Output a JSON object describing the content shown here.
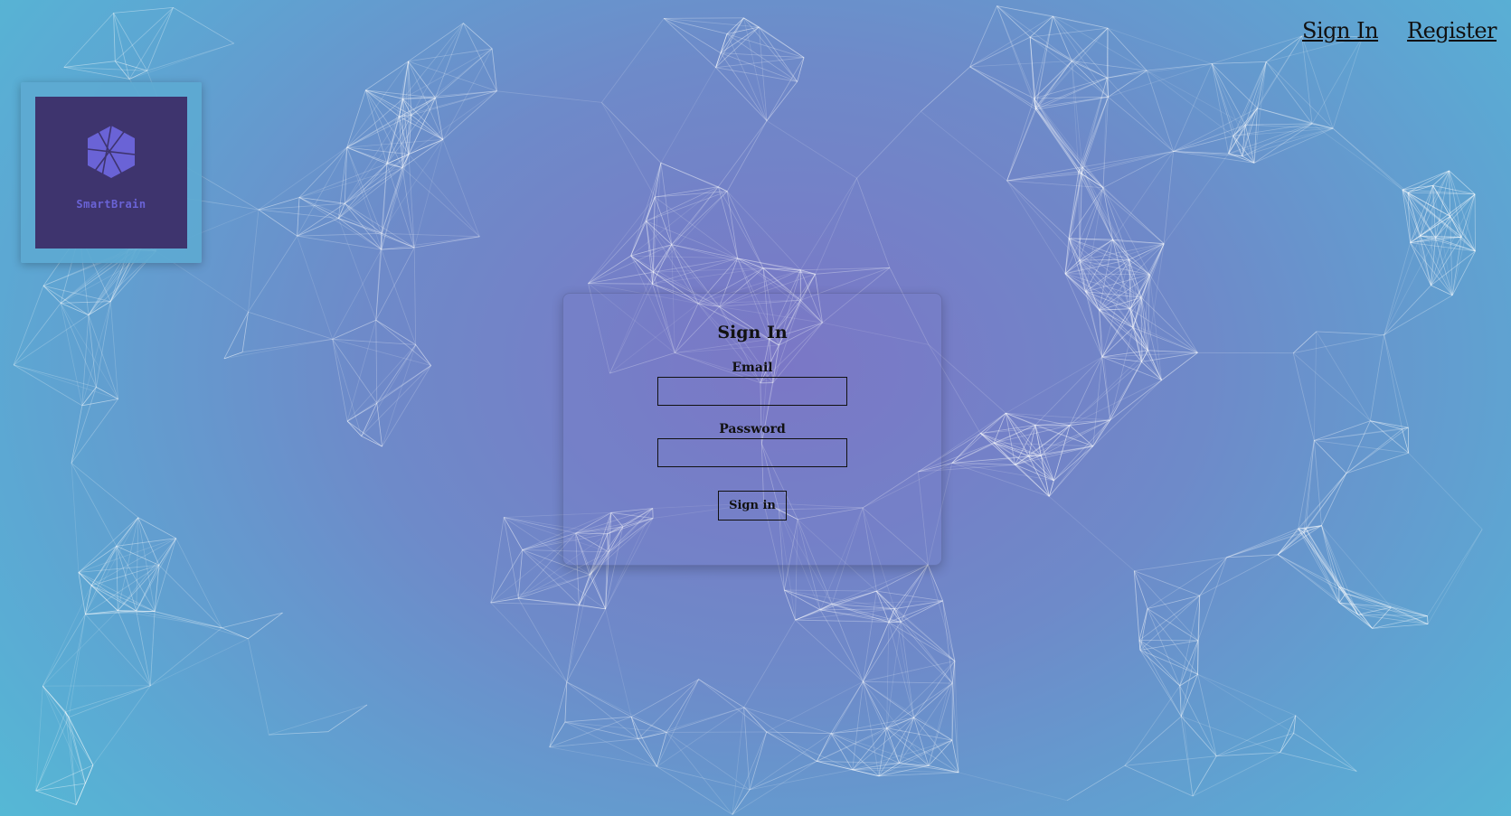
{
  "nav": {
    "sign_in_label": "Sign In",
    "register_label": "Register"
  },
  "logo": {
    "brand_name": "SmartBrain",
    "icon": "hexagon-brain-icon"
  },
  "signin_form": {
    "title": "Sign In",
    "email_label": "Email",
    "email_value": "",
    "password_label": "Password",
    "password_value": "",
    "submit_label": "Sign in"
  },
  "colors": {
    "bg_center": "#7b76c6",
    "bg_edge": "#53bdd6",
    "logo_bg": "#3e346e",
    "logo_accent": "#6a63d6",
    "network_line": "#ffffff"
  }
}
